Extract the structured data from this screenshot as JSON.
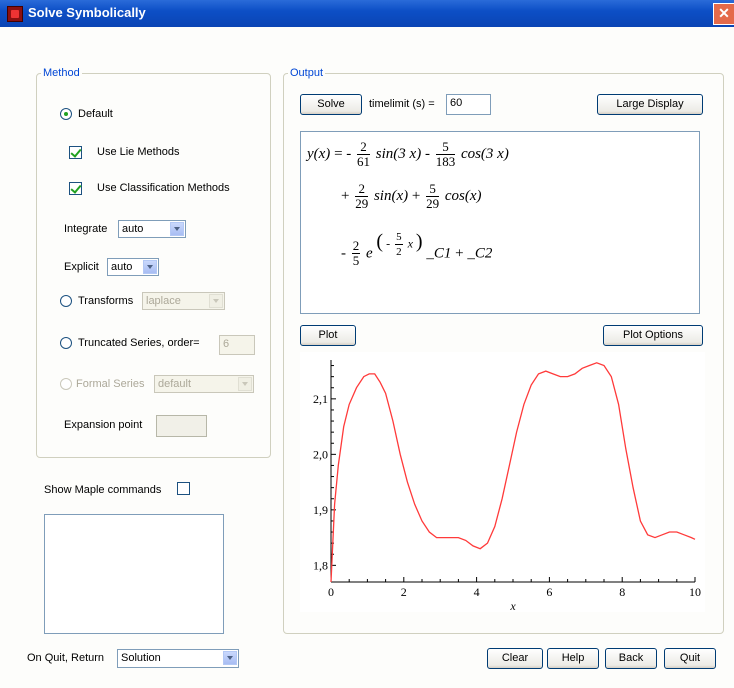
{
  "window": {
    "title": "Solve Symbolically",
    "close_glyph": "✕"
  },
  "method": {
    "legend": "Method",
    "default_label": "Default",
    "use_lie_label": "Use Lie Methods",
    "use_classification_label": "Use Classification Methods",
    "integrate_label": "Integrate",
    "integrate_value": "auto",
    "explicit_label": "Explicit",
    "explicit_value": "auto",
    "transforms_label": "Transforms",
    "transforms_value": "laplace",
    "truncated_label": "Truncated Series, order=",
    "truncated_order": "6",
    "formal_label": "Formal Series",
    "formal_value": "default",
    "expansion_label": "Expansion point",
    "expansion_value": ""
  },
  "maple": {
    "show_label": "Show Maple commands",
    "commands_text": ""
  },
  "output": {
    "legend": "Output",
    "solve_button": "Solve",
    "timelimit_label": "timelimit (s) =",
    "timelimit_value": "60",
    "large_display_button": "Large Display",
    "plot_button": "Plot",
    "plot_options_button": "Plot Options",
    "math": {
      "lhs": "y(x)",
      "line1_sign1": "= -",
      "line1_f1_num": "2",
      "line1_f1_den": "61",
      "line1_t1": "sin(3 x)",
      "line1_sign2": "-",
      "line1_f2_num": "5",
      "line1_f2_den": "183",
      "line1_t2": "cos(3 x)",
      "line2_sign1": "+",
      "line2_f1_num": "2",
      "line2_f1_den": "29",
      "line2_t1": "sin(x)",
      "line2_sign2": "+",
      "line2_f2_num": "5",
      "line2_f2_den": "29",
      "line2_t2": "cos(x)",
      "line3_sign1": "-",
      "line3_f1_num": "2",
      "line3_f1_den": "5",
      "line3_base": "e",
      "line3_exp_open": "(",
      "line3_exp_sign": "-",
      "line3_exp_num": "5",
      "line3_exp_den": "2",
      "line3_exp_var": "x",
      "line3_exp_close": ")",
      "line3_t1": "_C1",
      "line3_sign2": "+",
      "line3_t2": "_C2"
    }
  },
  "footer": {
    "on_quit_label": "On Quit, Return",
    "on_quit_value": "Solution",
    "clear_button": "Clear",
    "help_button": "Help",
    "back_button": "Back",
    "quit_button": "Quit"
  },
  "chart_data": {
    "type": "line",
    "xlabel": "x",
    "ylabel": "",
    "xlim": [
      0,
      10
    ],
    "ylim": [
      1.77,
      2.17
    ],
    "x_ticks": [
      "0",
      "2",
      "4",
      "6",
      "8",
      "10"
    ],
    "y_ticks": [
      "1,8",
      "1,9",
      "2,0",
      "2,1"
    ],
    "line_color": "#ff3a3a",
    "series": [
      {
        "x": [
          0,
          0.1,
          0.2,
          0.35,
          0.5,
          0.7,
          0.9,
          1.05,
          1.2,
          1.35,
          1.5,
          1.7,
          1.9,
          2.1,
          2.3,
          2.5,
          2.7,
          2.9,
          3.1,
          3.3,
          3.5,
          3.7,
          3.9,
          4.1,
          4.3,
          4.5,
          4.7,
          4.9,
          5.1,
          5.3,
          5.5,
          5.7,
          5.9,
          6.1,
          6.3,
          6.5,
          6.7,
          6.9,
          7.1,
          7.3,
          7.5,
          7.7,
          7.9,
          8.1,
          8.3,
          8.5,
          8.7,
          8.9,
          9.1,
          9.3,
          9.5,
          9.7,
          9.9,
          10
        ],
        "y": [
          1.77,
          1.91,
          1.98,
          2.05,
          2.09,
          2.12,
          2.14,
          2.145,
          2.145,
          2.13,
          2.11,
          2.06,
          2.0,
          1.95,
          1.91,
          1.88,
          1.86,
          1.85,
          1.85,
          1.85,
          1.85,
          1.845,
          1.835,
          1.83,
          1.84,
          1.87,
          1.92,
          1.98,
          2.04,
          2.09,
          2.125,
          2.145,
          2.15,
          2.145,
          2.14,
          2.14,
          2.145,
          2.155,
          2.16,
          2.165,
          2.16,
          2.14,
          2.09,
          2.01,
          1.94,
          1.88,
          1.855,
          1.85,
          1.855,
          1.86,
          1.86,
          1.855,
          1.85,
          1.847
        ]
      }
    ]
  }
}
